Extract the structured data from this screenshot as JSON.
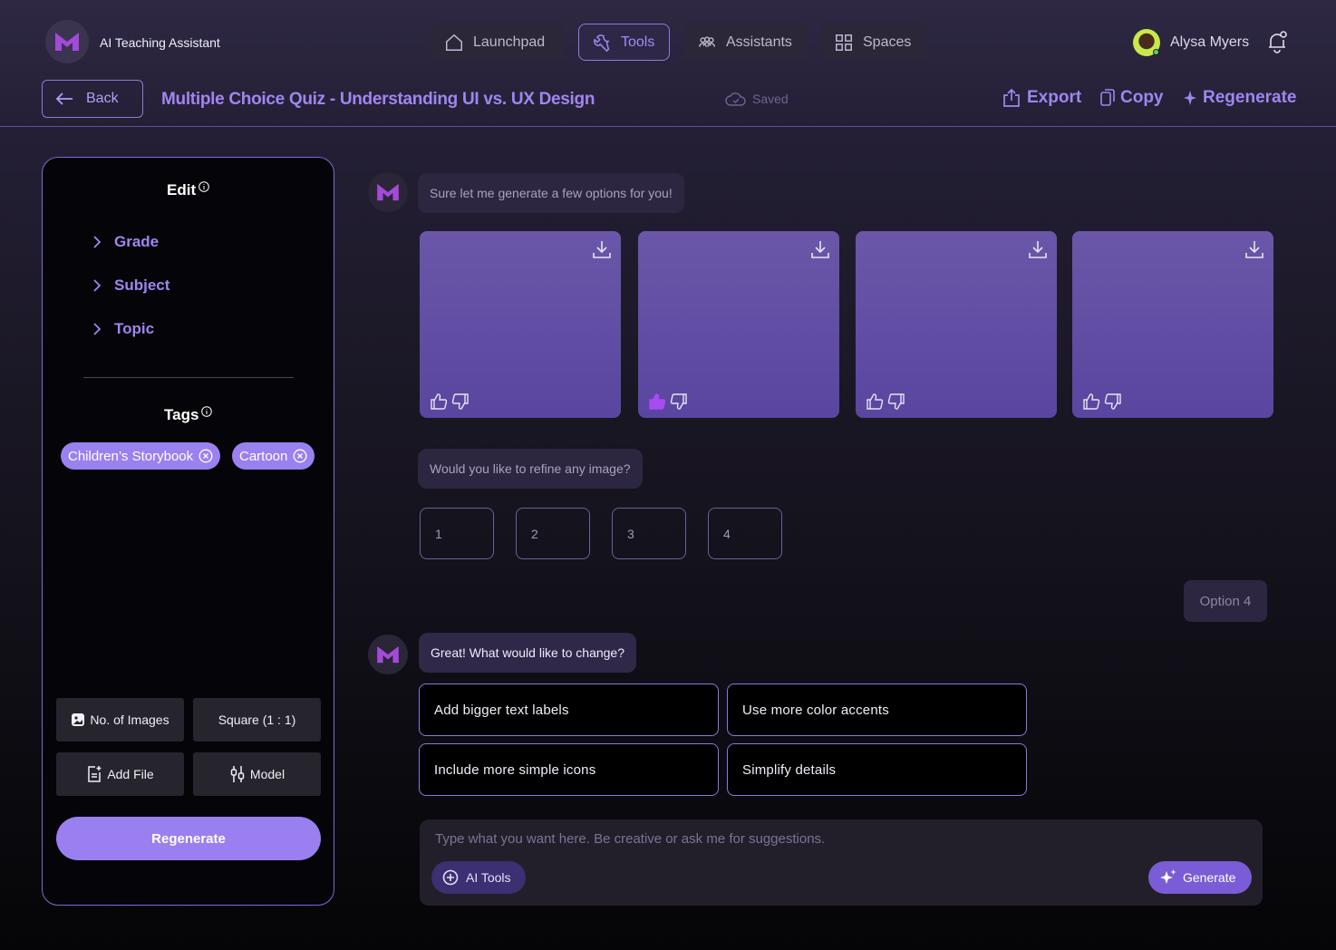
{
  "app": {
    "name": "AI Teaching Assistant"
  },
  "nav": {
    "tabs": [
      {
        "label": "Launchpad",
        "icon": "home-icon"
      },
      {
        "label": "Tools",
        "icon": "wrench-icon",
        "active": true
      },
      {
        "label": "Assistants",
        "icon": "users-icon"
      },
      {
        "label": "Spaces",
        "icon": "grid-icon"
      }
    ]
  },
  "user": {
    "name": "Alysa Myers"
  },
  "header": {
    "back_label": "Back",
    "title": "Multiple Choice Quiz - Understanding UI vs. UX Design",
    "saved_label": "Saved",
    "export_label": "Export",
    "copy_label": "Copy",
    "regenerate_label": "Regenerate"
  },
  "panel": {
    "edit_heading": "Edit",
    "items": [
      "Grade",
      "Subject",
      "Topic"
    ],
    "tags_heading": "Tags",
    "tags": [
      "Children’s Storybook",
      "Cartoon"
    ],
    "no_images_label": "No. of Images",
    "aspect_label": "Square (1 : 1)",
    "add_file_label": "Add File",
    "model_label": "Model",
    "regenerate_label": "Regenerate"
  },
  "chat": {
    "msg1": "Sure let me generate a few options for you!",
    "refine_question": "Would you like to refine any image?",
    "options": [
      "1",
      "2",
      "3",
      "4"
    ],
    "user_reply": "Option 4",
    "msg2": "Great! What would like to change?",
    "suggestions": [
      "Add bigger text labels",
      "Use more color accents",
      "Include more simple icons",
      "Simplify details"
    ]
  },
  "composer": {
    "placeholder": "Type what you want here. Be creative or ask me for suggestions.",
    "ai_tools_label": "AI Tools",
    "generate_label": "Generate"
  },
  "colors": {
    "accent": "#9f86f0",
    "tag_bg": "#9b80f0",
    "logo": "#a34ad8"
  }
}
